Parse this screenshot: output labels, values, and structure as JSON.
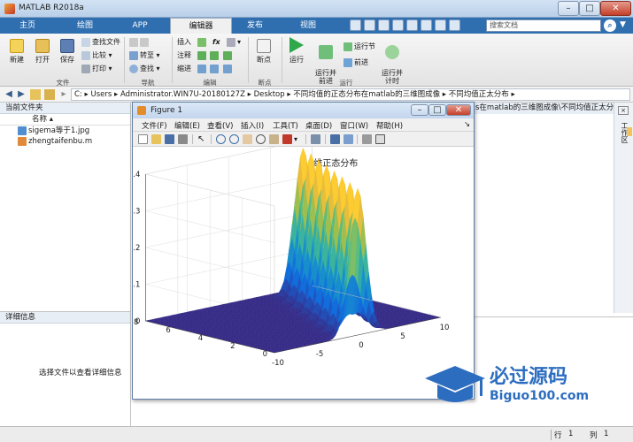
{
  "app": {
    "title": "MATLAB R2018a"
  },
  "tabs": [
    {
      "label": "主页"
    },
    {
      "label": "绘图"
    },
    {
      "label": "APP"
    },
    {
      "label": "编辑器"
    },
    {
      "label": "发布"
    },
    {
      "label": "视图"
    }
  ],
  "search": {
    "placeholder": "搜索文档"
  },
  "ribbon": {
    "file": {
      "new": "新建",
      "open": "打开",
      "save": "保存",
      "find_files": "查找文件",
      "compare": "比较",
      "print": "打印",
      "label": "文件"
    },
    "navigate": {
      "goto": "转至",
      "find": "查找",
      "label": "导航"
    },
    "edit": {
      "insert": "插入",
      "comment": "注释",
      "indent": "缩进",
      "fx": "fx",
      "label": "编辑"
    },
    "breakpoints": {
      "btn": "断点",
      "label": "断点"
    },
    "run": {
      "run": "运行",
      "run_advance": "运行并\n前进",
      "run_section": "运行节",
      "advance": "前进",
      "run_time": "运行并\n计时",
      "label": "运行"
    }
  },
  "address": {
    "segments": [
      "C:",
      "Users",
      "Administrator.WIN7U-20180127Z",
      "Desktop",
      "不同均值的正态分布在matlab的三维图成像",
      "不同均值正太分布"
    ]
  },
  "current_folder": {
    "header": "当前文件夹",
    "col_name": "名称",
    "files": [
      {
        "name": "sigema等于1.jpg",
        "icon": "image-file-icon"
      },
      {
        "name": "zhengtaifenbu.m",
        "icon": "m-file-icon"
      }
    ]
  },
  "details": {
    "header": "详细信息",
    "hint": "选择文件以查看详细信息"
  },
  "command_header": "s在matlab的三维图成像\\不同均值正太分...",
  "workspace_tab": "工作区",
  "status": {
    "row_label": "行",
    "row": "1",
    "col_label": "列",
    "col": "1"
  },
  "figure": {
    "title": "Figure 1",
    "menu": [
      "文件(F)",
      "编辑(E)",
      "查看(V)",
      "插入(I)",
      "工具(T)",
      "桌面(D)",
      "窗口(W)",
      "帮助(H)"
    ],
    "plot_title": "sigema为1的三维正态分布",
    "z_ticks": [
      "0.4",
      "0.3",
      "0.2",
      "0.1",
      "0"
    ],
    "y_ticks": [
      "8",
      "6",
      "4",
      "2",
      "0"
    ],
    "x_ticks": [
      "-10",
      "-5",
      "0",
      "5",
      "10"
    ]
  },
  "chart_data": {
    "type": "area",
    "title": "sigema为1的三维正态分布",
    "description_kind": "3d-surface",
    "x_range": [
      -10,
      10
    ],
    "y_range": [
      0,
      8
    ],
    "z_range": [
      0,
      0.4
    ],
    "series": [
      {
        "mean": 0,
        "sigma": 1,
        "peak": 0.4
      },
      {
        "mean": 1,
        "sigma": 1,
        "peak": 0.4
      },
      {
        "mean": 2,
        "sigma": 1,
        "peak": 0.4
      },
      {
        "mean": 3,
        "sigma": 1,
        "peak": 0.4
      },
      {
        "mean": 4,
        "sigma": 1,
        "peak": 0.4
      },
      {
        "mean": 5,
        "sigma": 1,
        "peak": 0.4
      },
      {
        "mean": 6,
        "sigma": 1,
        "peak": 0.4
      },
      {
        "mean": 7,
        "sigma": 1,
        "peak": 0.4
      }
    ],
    "colormap": "parula",
    "grid": true
  },
  "watermark": {
    "line1": "必过源码",
    "line2": "Biguo100.com"
  }
}
